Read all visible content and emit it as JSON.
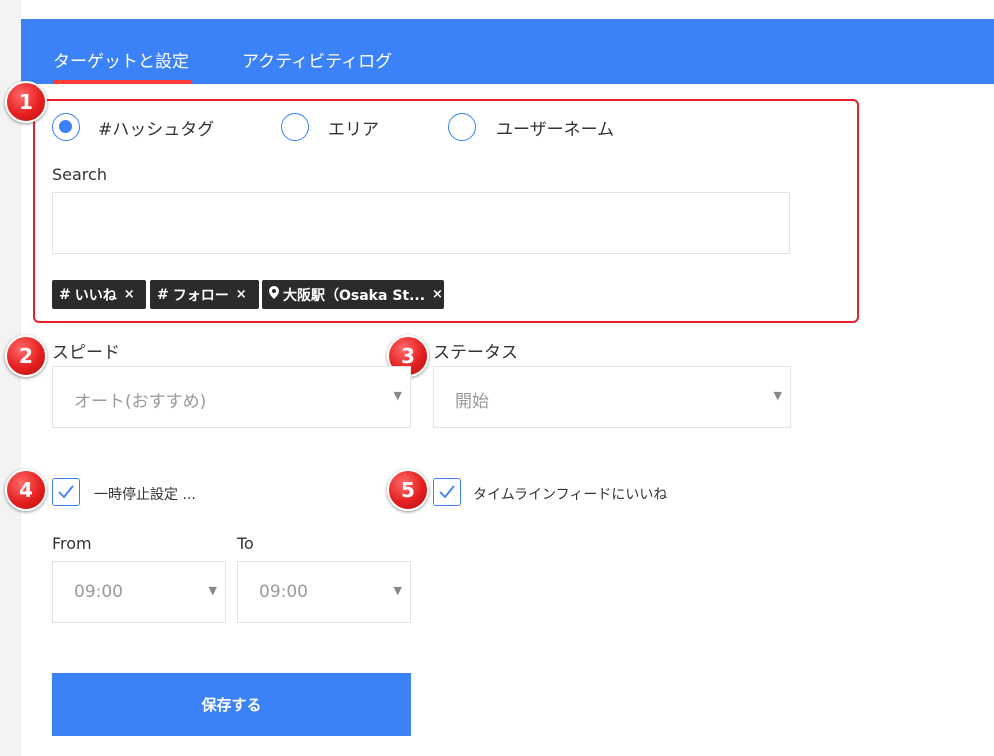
{
  "tabs": [
    {
      "label": "ターゲットと設定",
      "active": true
    },
    {
      "label": "アクティビティログ",
      "active": false
    }
  ],
  "badges": [
    "1",
    "2",
    "3",
    "4",
    "5"
  ],
  "target_type": {
    "options": [
      {
        "label": "#ハッシュタグ",
        "checked": true
      },
      {
        "label": "エリア",
        "checked": false
      },
      {
        "label": "ユーザーネーム",
        "checked": false
      }
    ]
  },
  "search": {
    "label": "Search",
    "value": "",
    "placeholder": ""
  },
  "tags": [
    {
      "icon": "hash-icon",
      "icon_glyph": "#",
      "text": "いいね",
      "close": "×"
    },
    {
      "icon": "hash-icon",
      "icon_glyph": "#",
      "text": "フォロー",
      "close": "×"
    },
    {
      "icon": "location-pin-icon",
      "icon_glyph": "",
      "text": "大阪駅（Osaka St...",
      "close": "×"
    }
  ],
  "speed": {
    "label": "スピード",
    "value": "オート(おすすめ)"
  },
  "status": {
    "label": "ステータス",
    "value": "開始"
  },
  "pause_setting": {
    "label": "一時停止設定 ...",
    "checked": true
  },
  "timeline_like": {
    "label": "タイムラインフィードにいいね",
    "checked": true
  },
  "from": {
    "label": "From",
    "value": "09:00"
  },
  "to": {
    "label": "To",
    "value": "09:00"
  },
  "save_button": {
    "label": "保存する"
  },
  "colors": {
    "accent": "#3b82f8",
    "highlight": "#e8202a",
    "tag_bg": "#2b2b2b"
  },
  "caret_glyph": "▼"
}
